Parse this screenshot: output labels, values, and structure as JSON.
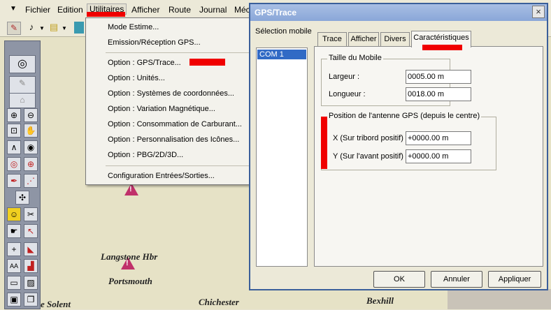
{
  "menubar": {
    "items": [
      "Fichier",
      "Edition",
      "Utilitaires",
      "Afficher",
      "Route",
      "Journal",
      "Méc"
    ]
  },
  "dropdown": {
    "items": [
      "Mode Estime...",
      "Emission/Réception GPS...",
      "Option : GPS/Trace...",
      "Option : Unités...",
      "Option : Systèmes de coordonnées...",
      "Option : Variation Magnétique...",
      "Option : Consommation de Carburant...",
      "Option : Personnalisation des Icônes...",
      "Option : PBG/2D/3D...",
      "Configuration Entrées/Sorties..."
    ]
  },
  "map": {
    "places": [
      "Langstone Hbr",
      "Portsmouth",
      "e Solent",
      "Chichester",
      "Bexhill"
    ]
  },
  "dialog": {
    "title": "GPS/Trace",
    "close": "×",
    "selection_label": "Sélection mobile",
    "com_item": "COM 1",
    "tabs": [
      "Trace",
      "Afficher",
      "Divers",
      "Caractéristiques"
    ],
    "group1": {
      "title": "Taille du Mobile",
      "width_label": "Largeur :",
      "width_value": "0005.00 m",
      "length_label": "Longueur :",
      "length_value": "0018.00 m"
    },
    "group2": {
      "title": "Position de l'antenne GPS (depuis le centre)",
      "x_label": "X (Sur tribord positif) :",
      "x_value": "+0000.00 m",
      "y_label": "Y (Sur l'avant positif) :",
      "y_value": "+0000.00 m"
    },
    "buttons": {
      "ok": "OK",
      "cancel": "Annuler",
      "apply": "Appliquer"
    }
  },
  "colors": {
    "highlight_red": "#f00000",
    "selection_blue": "#316ac5",
    "title_blue": "#8aa7d8"
  }
}
